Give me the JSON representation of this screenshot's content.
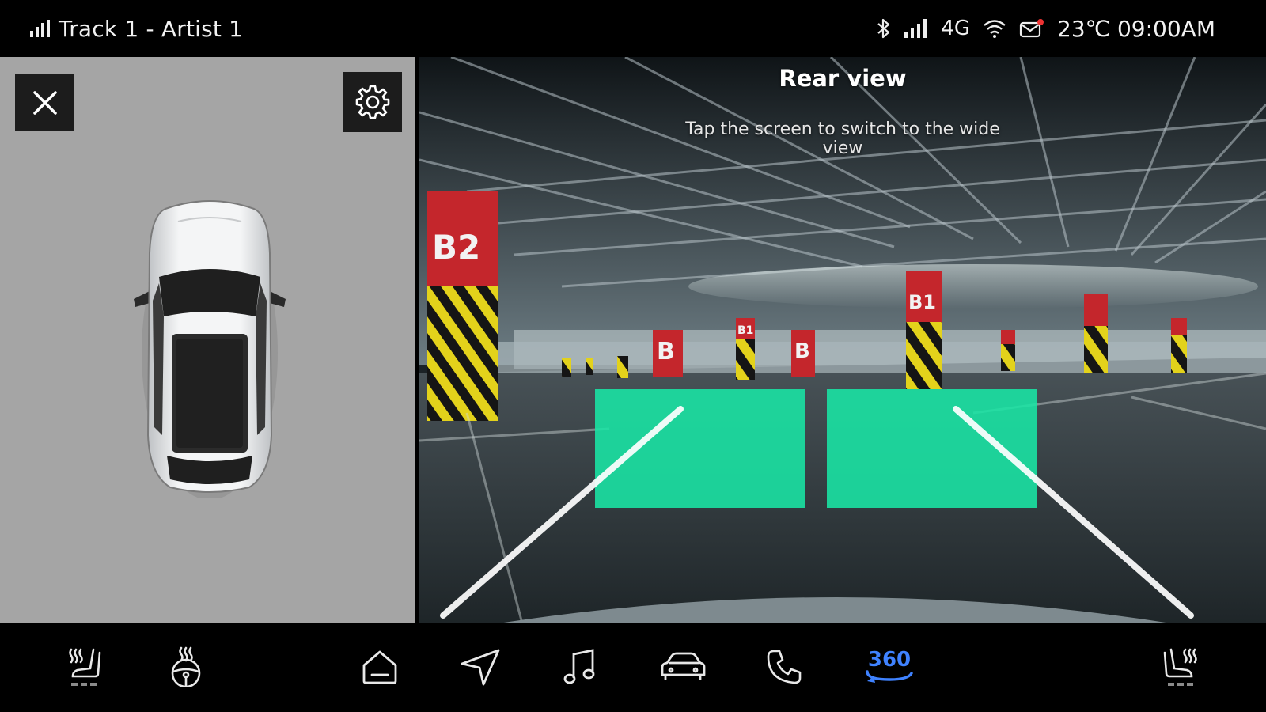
{
  "status_bar": {
    "now_playing": "Track 1 - Artist 1",
    "network": "4G",
    "temperature_time": "23℃ 09:00AM",
    "icons": [
      "signal-bars-icon",
      "bluetooth-icon",
      "cellular-signal-icon",
      "wifi-icon",
      "mail-icon"
    ]
  },
  "left_panel": {
    "close_icon": "close-icon",
    "settings_icon": "gear-icon",
    "vehicle": "car-top-view"
  },
  "camera": {
    "title": "Rear view",
    "hint": "Tap the screen to switch to the wide view",
    "pillar_labels": [
      "B2",
      "B1",
      "B",
      "B",
      "B1"
    ]
  },
  "dock": {
    "items": [
      {
        "name": "seat-heat-left",
        "icon": "seat-heat-icon"
      },
      {
        "name": "steering-heat",
        "icon": "steering-wheel-heat-icon"
      },
      {
        "name": "home",
        "icon": "home-icon"
      },
      {
        "name": "navigation",
        "icon": "navigation-icon"
      },
      {
        "name": "music",
        "icon": "music-note-icon"
      },
      {
        "name": "vehicle",
        "icon": "car-icon"
      },
      {
        "name": "phone",
        "icon": "phone-icon"
      },
      {
        "name": "surround-view",
        "label": "360",
        "icon": "rotate-360-icon",
        "active": true
      },
      {
        "name": "seat-heat-right",
        "icon": "seat-heat-icon"
      }
    ],
    "active_color": "#3f82ff"
  },
  "colors": {
    "guide_zone": "#19e6a5",
    "panel_bg": "#a5a5a5"
  }
}
